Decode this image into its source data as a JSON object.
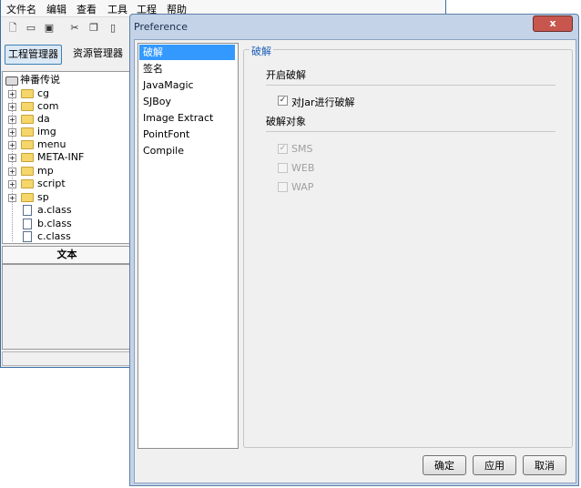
{
  "main_window": {
    "menu": [
      "文件名",
      "编辑",
      "查看",
      "工具",
      "工程",
      "帮助"
    ],
    "toolbar_icons": [
      "new-file-icon",
      "open-icon",
      "save-icon",
      "cut-icon",
      "copy-icon",
      "paste-icon"
    ],
    "tabs": [
      {
        "label": "工程管理器",
        "active": true
      },
      {
        "label": "资源管理器",
        "active": false
      }
    ],
    "tree": {
      "root": "神番传说",
      "folders": [
        "cg",
        "com",
        "da",
        "img",
        "menu",
        "META-INF",
        "mp",
        "script",
        "sp"
      ],
      "files": [
        "a.class",
        "b.class",
        "c.class"
      ]
    },
    "text_panel_header": "文本"
  },
  "dialog": {
    "title": "Preference",
    "close_label": "x",
    "categories": [
      "破解",
      "签名",
      "JavaMagic",
      "SJBoy",
      "Image Extract",
      "PointFont",
      "Compile"
    ],
    "selected_category": "破解",
    "group_title": "破解",
    "section_enable": "开启破解",
    "enable_checkbox": {
      "label": "对Jar进行破解",
      "checked": true
    },
    "section_targets": "破解对象",
    "targets": [
      {
        "label": "SMS",
        "checked": true,
        "disabled": true
      },
      {
        "label": "WEB",
        "checked": false,
        "disabled": true
      },
      {
        "label": "WAP",
        "checked": false,
        "disabled": true
      }
    ],
    "buttons": {
      "ok": "确定",
      "apply": "应用",
      "cancel": "取消"
    }
  },
  "colors": {
    "selection": "#3399ff",
    "group_title": "#1e5eb8",
    "close_button": "#c7574e"
  }
}
